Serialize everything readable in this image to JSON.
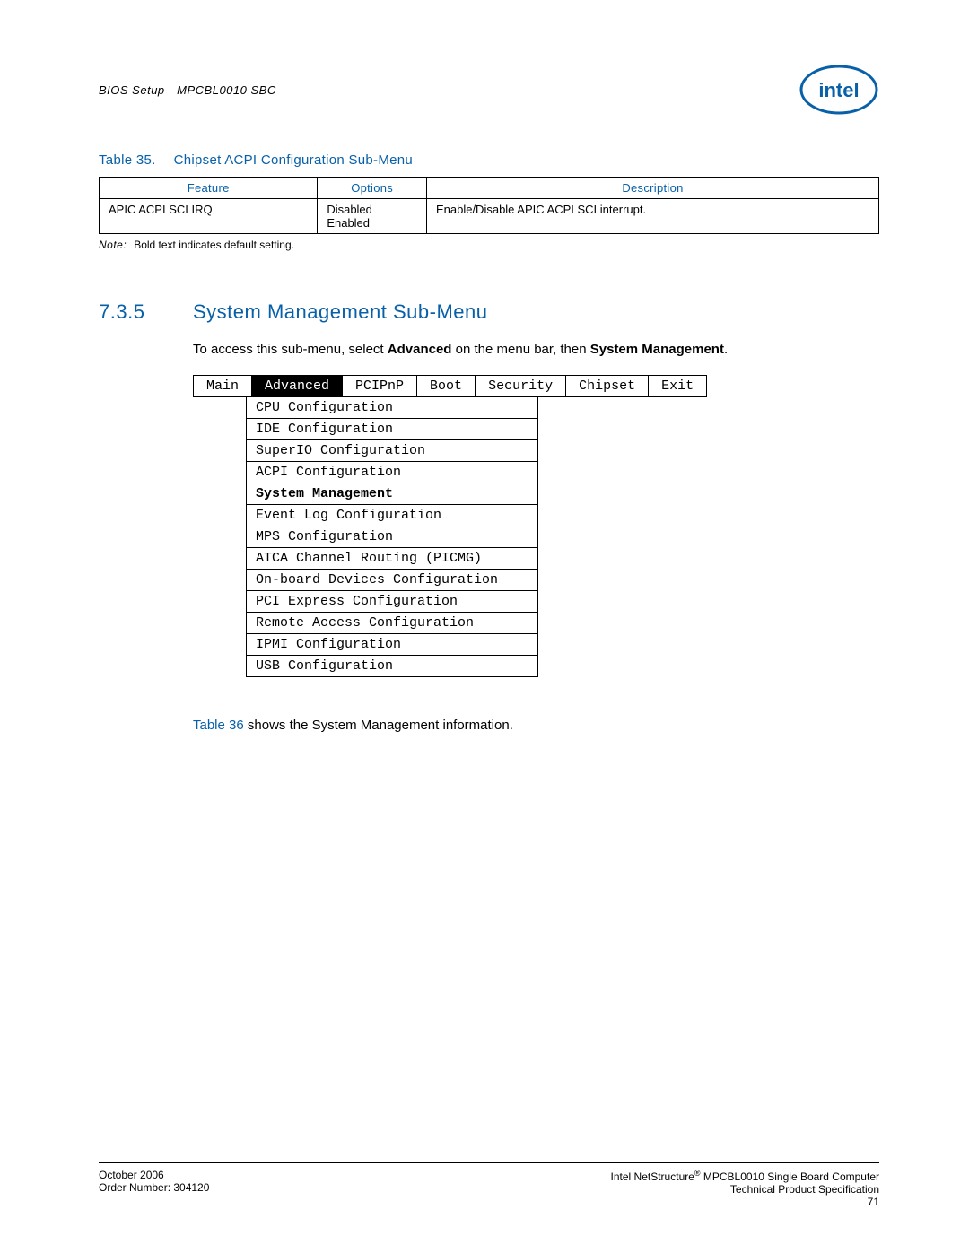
{
  "header": {
    "doc_title": "BIOS Setup—MPCBL0010 SBC"
  },
  "table35": {
    "label": "Table 35.",
    "title": "Chipset ACPI Configuration Sub-Menu",
    "headers": {
      "feature": "Feature",
      "options": "Options",
      "description": "Description"
    },
    "row": {
      "feature": "APIC ACPI SCI IRQ",
      "option1": "Disabled",
      "option2": "Enabled",
      "description": "Enable/Disable APIC ACPI SCI interrupt."
    },
    "note_label": "Note:",
    "note_text": "Bold text indicates default setting."
  },
  "section": {
    "number": "7.3.5",
    "title": "System Management Sub-Menu",
    "intro_a": "To access this sub-menu, select ",
    "intro_b": "Advanced",
    "intro_c": " on the menu bar, then ",
    "intro_d": "System Management",
    "intro_e": "."
  },
  "menu": {
    "tabs": [
      "Main",
      "Advanced",
      "PCIPnP",
      "Boot",
      "Security",
      "Chipset",
      "Exit"
    ],
    "active_index": 1,
    "items": [
      "CPU Configuration",
      "IDE Configuration",
      "SuperIO Configuration",
      "ACPI Configuration",
      "System Management",
      "Event Log Configuration",
      "MPS Configuration",
      "ATCA Channel Routing (PICMG)",
      "On-board Devices Configuration",
      "PCI Express Configuration",
      "Remote Access Configuration",
      "IPMI Configuration",
      "USB Configuration"
    ],
    "selected_index": 4
  },
  "reference": {
    "link": "Table 36",
    "rest": " shows the System Management information."
  },
  "footer": {
    "left1": "October 2006",
    "left2": "Order Number: 304120",
    "right1a": "Intel NetStructure",
    "right1b": " MPCBL0010 Single Board Computer",
    "right2": "Technical Product Specification",
    "right3": "71"
  }
}
